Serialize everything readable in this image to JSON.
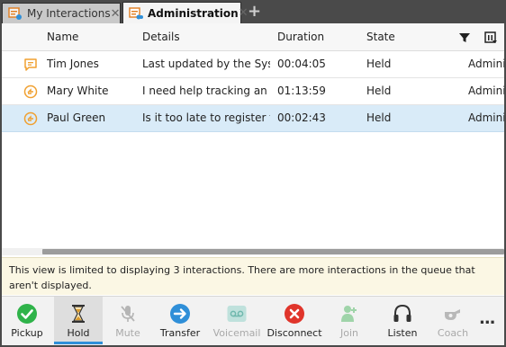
{
  "tabs": [
    {
      "label": "My Interactions",
      "active": false
    },
    {
      "label": "Administration",
      "active": true
    }
  ],
  "grid": {
    "columns": [
      "Name",
      "Details",
      "Duration",
      "State"
    ],
    "rows": [
      {
        "name": "Tim Jones",
        "details": "Last updated by the Sys…",
        "duration": "00:04:05",
        "state": "Held",
        "extra": "Adminis",
        "type_icon": "chat-icon",
        "selected": false
      },
      {
        "name": "Mary White",
        "details": "I need help tracking an …",
        "duration": "01:13:59",
        "state": "Held",
        "extra": "Adminis",
        "type_icon": "callback-icon",
        "selected": false
      },
      {
        "name": "Paul Green",
        "details": "Is it too late to register f…",
        "duration": "00:02:43",
        "state": "Held",
        "extra": "Adminis",
        "type_icon": "callback-icon",
        "selected": true
      }
    ]
  },
  "notice": "This view is limited to displaying 3 interactions. There are more interactions in the queue that aren't displayed.",
  "toolbar": {
    "pickup": "Pickup",
    "hold": "Hold",
    "mute": "Mute",
    "transfer": "Transfer",
    "voicemail": "Voicemail",
    "disconnect": "Disconnect",
    "join": "Join",
    "listen": "Listen",
    "coach": "Coach",
    "more": "..."
  },
  "colors": {
    "accent": "#2f8fd8",
    "pickup": "#2fb34a",
    "disconnect": "#e0352b",
    "hold": "#d99a2b",
    "interaction_icon": "#f0a030"
  }
}
